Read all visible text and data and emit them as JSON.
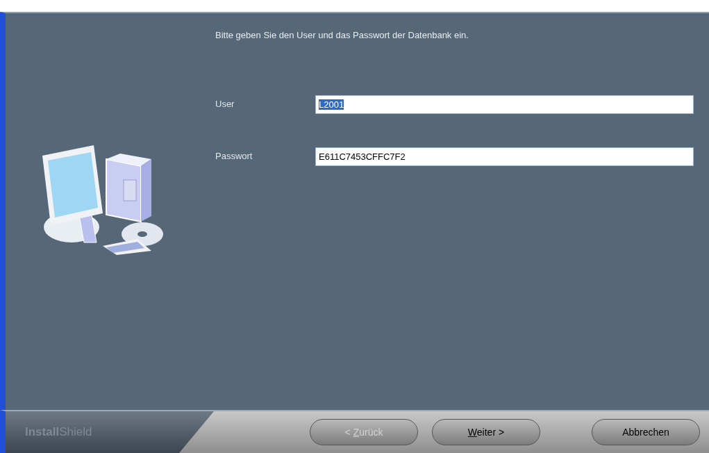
{
  "dialog": {
    "instruction": "Bitte geben Sie den User und das Passwort der Datenbank ein.",
    "fields": [
      {
        "label": "User",
        "value": "L2001",
        "text_selected": true
      },
      {
        "label": "Passwort",
        "value": "E611C7453CFFC7F2",
        "text_selected": false
      }
    ]
  },
  "footer": {
    "brand_bold": "Install",
    "brand_rest": "Shield",
    "buttons": [
      {
        "prefix": "< ",
        "mnemonic": "Z",
        "rest": "urück",
        "disabled": true
      },
      {
        "mnemonic": "W",
        "rest": "eiter >",
        "disabled": false
      },
      {
        "rest": "Abbrechen",
        "disabled": false
      }
    ]
  }
}
